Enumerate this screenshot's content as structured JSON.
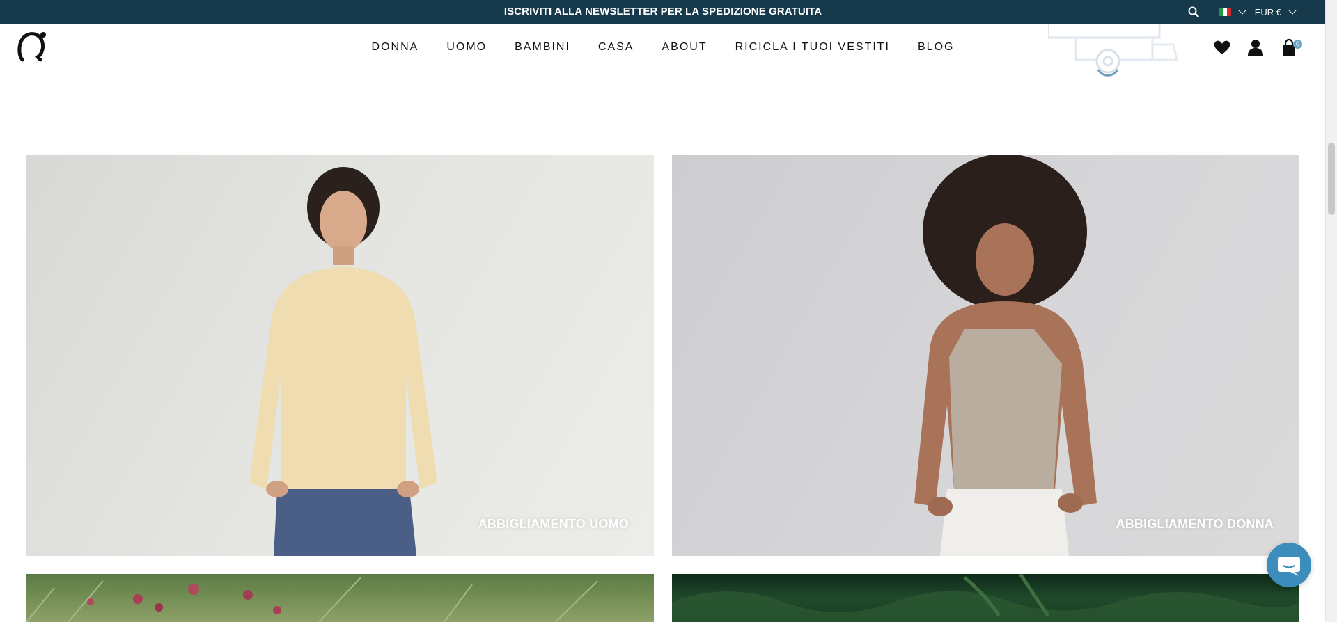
{
  "announcement": {
    "text": "ISCRIVITI ALLA NEWSLETTER PER LA SPEDIZIONE GRATUITA",
    "currency": "EUR €"
  },
  "header": {
    "nav": [
      "DONNA",
      "UOMO",
      "BAMBINI",
      "CASA",
      "ABOUT",
      "RICICLA I TUOI VESTITI",
      "BLOG"
    ],
    "cart_count": "0"
  },
  "categories": {
    "men_label": "ABBIGLIAMENTO UOMO",
    "women_label": "ABBIGLIAMENTO DONNA"
  },
  "colors": {
    "announcement_bg": "#163a4b",
    "cart_badge": "#6aa8c7",
    "chat_button": "#3c8dbc"
  }
}
